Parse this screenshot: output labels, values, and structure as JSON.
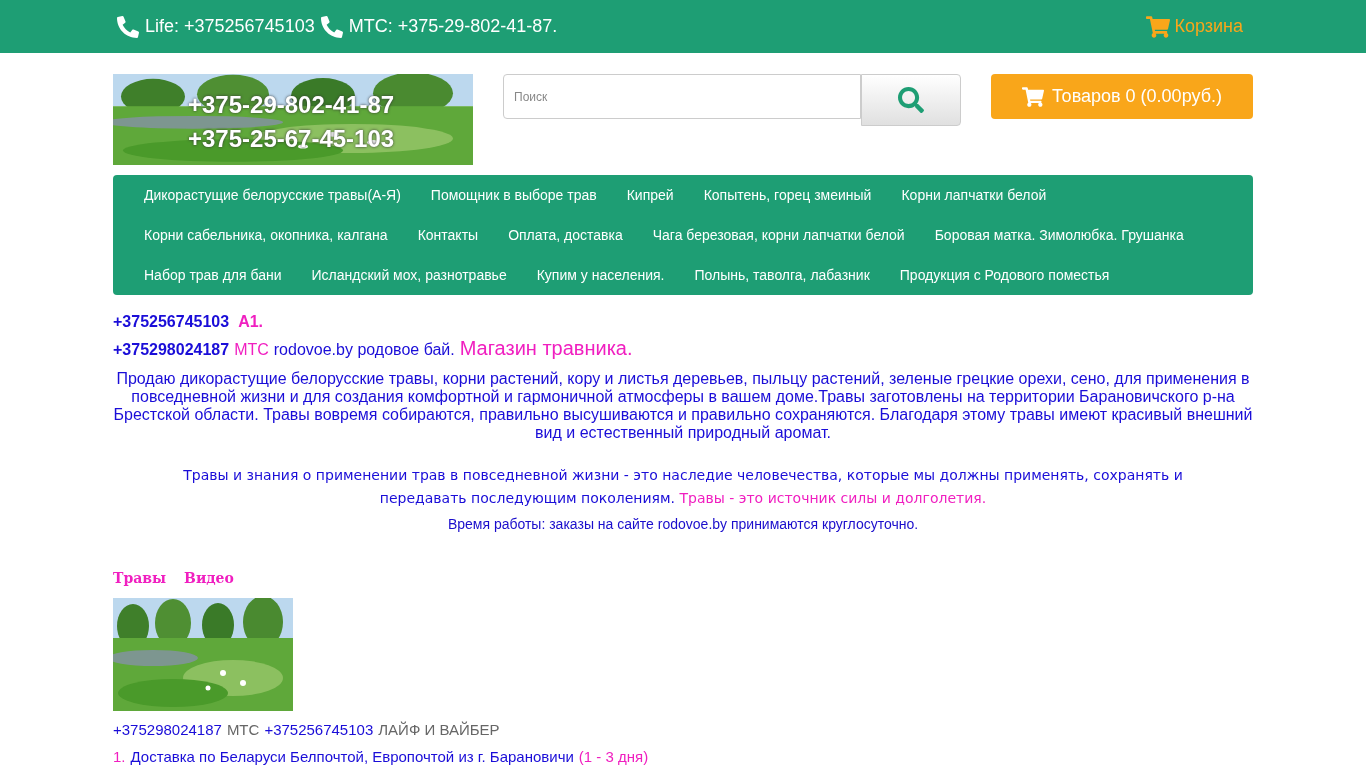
{
  "top_bar": {
    "phones": [
      {
        "text": "Life: +375256745103"
      },
      {
        "text": "МТС: +375-29-802-41-87."
      }
    ],
    "cart_link": "Корзина"
  },
  "header": {
    "banner": {
      "kind": "picture",
      "lines": [
        "+375-29-802-41-87",
        "+375-25-67-45-103"
      ]
    },
    "search": {
      "placeholder": "Поиск"
    },
    "cart_button": "Товаров 0 (0.00руб.)"
  },
  "menu": [
    {
      "label": "Дикорастущие белорусские травы(А-Я)"
    },
    {
      "label": "Помощник в выборе трав"
    },
    {
      "label": "Кипрей"
    },
    {
      "label": "Копытень, горец змеиный"
    },
    {
      "label": "Корни лапчатки белой"
    },
    {
      "label": "Корни сабельника, окопника, калгана"
    },
    {
      "label": "Контакты"
    },
    {
      "label": "Оплата, доставка"
    },
    {
      "label": "Чага березовая, корни лапчатки белой"
    },
    {
      "label": "Боровая матка. Зимолюбка. Грушанка"
    },
    {
      "label": "Набор трав для бани"
    },
    {
      "label": "Исландский мох, разнотравье"
    },
    {
      "label": "Купим у населения."
    },
    {
      "label": "Полынь, таволга, лабазник"
    },
    {
      "label": "Продукция с Родового поместья"
    }
  ],
  "contacts": [
    [
      {
        "kind": "strong",
        "text": "+375256745103"
      },
      {
        "kind": "accent_strong",
        "text": "А1."
      }
    ],
    [
      {
        "kind": "strong",
        "text": "+375298024187"
      },
      {
        "kind": "accent",
        "text": "МТС"
      },
      {
        "kind": "plain",
        "text": "rodovoe.by родовое бай."
      },
      {
        "kind": "big_accent",
        "text": "Магазин травника."
      }
    ]
  ],
  "intro": "Продаю дикорастущие белорусские травы, корни растений, кору и листья деревьев, пыльцу растений, зеленые грецкие орехи, сено, для применения в повседневной жизни и для создания комфортной и гармоничной атмосферы в вашем доме.Травы заготовлены на территории Барановичского р-на Брестской области. Травы вовремя собираются, правильно высушиваются и правильно сохраняются. Благодаря этому травы имеют красивый внешний вид и естественный природный аромат.",
  "heritage": [
    {
      "kind": "plain",
      "text": "Травы и знания о применении трав в повседневной жизни - это наследие человечества, которые мы должны применять, сохранять и передавать последующим поколениям."
    },
    {
      "kind": "accent",
      "text": "Травы - это источник силы и долголетия."
    }
  ],
  "hours": "Время работы: заказы на сайте rodovoe.by принимаются круглосуточно.",
  "tabs": [
    {
      "label": "Травы"
    },
    {
      "label": "Видео"
    }
  ],
  "phones_line": [
    {
      "kind": "phone",
      "text": "+375298024187"
    },
    {
      "kind": "grey",
      "text": "МТС"
    },
    {
      "kind": "phone",
      "text": "+375256745103"
    },
    {
      "kind": "grey",
      "text": "ЛАЙФ И ВАЙБЕР"
    }
  ],
  "delivery": [
    {
      "number": "1.",
      "text": "Доставка по Беларуси Белпочтой, Европочтой из г. Барановичи",
      "note": "(1 - 3 дня)"
    }
  ]
}
